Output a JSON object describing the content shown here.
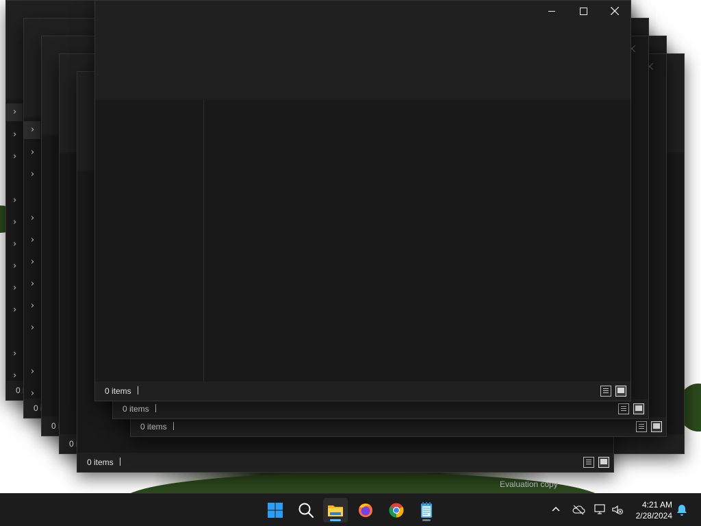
{
  "desktop": {
    "watermark": "Evaluation copy"
  },
  "windows": [
    {
      "id": "w1",
      "status_count": "0 i"
    },
    {
      "id": "w2",
      "status_count": "0 i"
    },
    {
      "id": "w3",
      "status_count": "0 i"
    },
    {
      "id": "w4",
      "status_count": "0 i"
    },
    {
      "id": "w5",
      "status_count": "0 items"
    },
    {
      "id": "w6",
      "status_count": "0 items"
    },
    {
      "id": "w7",
      "status_count": "0 items"
    },
    {
      "id": "w8",
      "status_count": "0 items"
    }
  ],
  "front_window": {
    "caption_buttons": [
      "minimize-icon",
      "maximize-icon",
      "close-icon"
    ]
  },
  "taskbar": {
    "apps": [
      "windows-start-icon",
      "search-icon",
      "file-explorer-icon",
      "firefox-icon",
      "chrome-icon",
      "notepad-icon"
    ],
    "tray": [
      "chevron-up-icon",
      "onedrive-icon",
      "network-icon",
      "volume-muted-icon",
      "notification-bell-icon"
    ],
    "time": "4:21 AM",
    "date": "2/28/2024",
    "accent_color": "#4cc2ff"
  }
}
